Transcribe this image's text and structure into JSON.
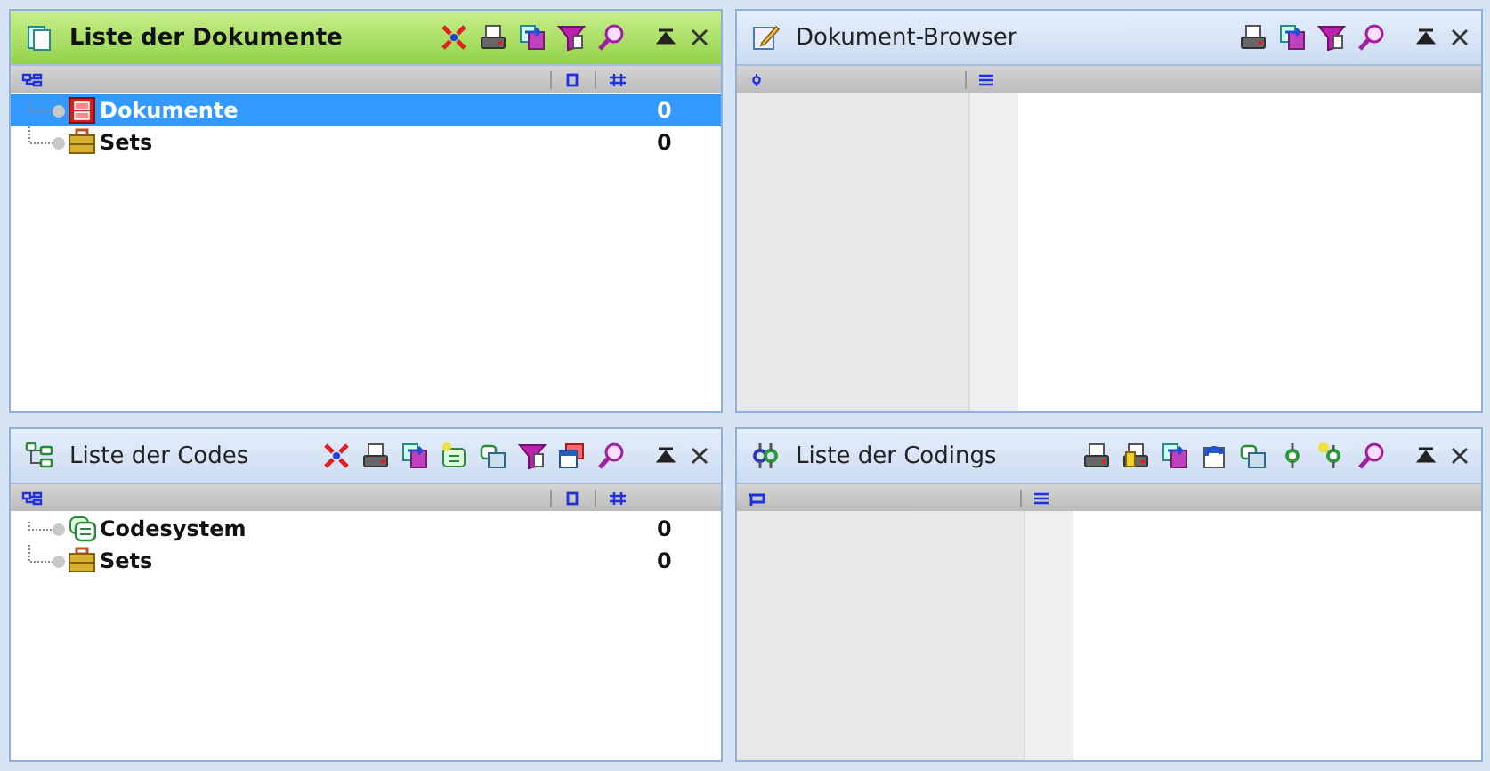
{
  "panels": [
    {
      "title": "Liste der Dokumente",
      "active": true,
      "kind": "tree",
      "items": [
        {
          "label": "Dokumente",
          "count": "0",
          "selected": true
        },
        {
          "label": "Sets",
          "count": "0",
          "selected": false
        }
      ]
    },
    {
      "title": "Dokument-Browser",
      "active": false,
      "kind": "browser"
    },
    {
      "title": "Liste der Codes",
      "active": false,
      "kind": "tree",
      "items": [
        {
          "label": "Codesystem",
          "count": "0",
          "selected": false
        },
        {
          "label": "Sets",
          "count": "0",
          "selected": false
        }
      ]
    },
    {
      "title": "Liste der Codings",
      "active": false,
      "kind": "browser"
    }
  ]
}
